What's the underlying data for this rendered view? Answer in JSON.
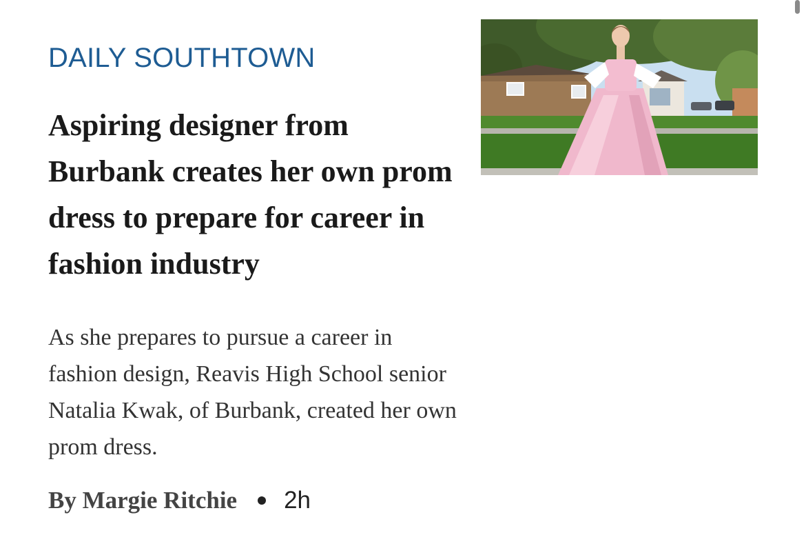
{
  "article": {
    "source": "DAILY SOUTHTOWN",
    "headline": "Aspiring designer from Burbank creates her own prom dress to prepare for career in fashion industry",
    "summary": "As she prepares to pursue a career in fashion design, Reavis High School senior Natalia Kwak, of Burbank, created her own prom dress.",
    "author": "By Margie Ritchie",
    "time": "2h"
  },
  "colors": {
    "source_label": "#1e5c93",
    "headline": "#1a1a1a",
    "summary": "#333333",
    "byline": "#444444"
  }
}
